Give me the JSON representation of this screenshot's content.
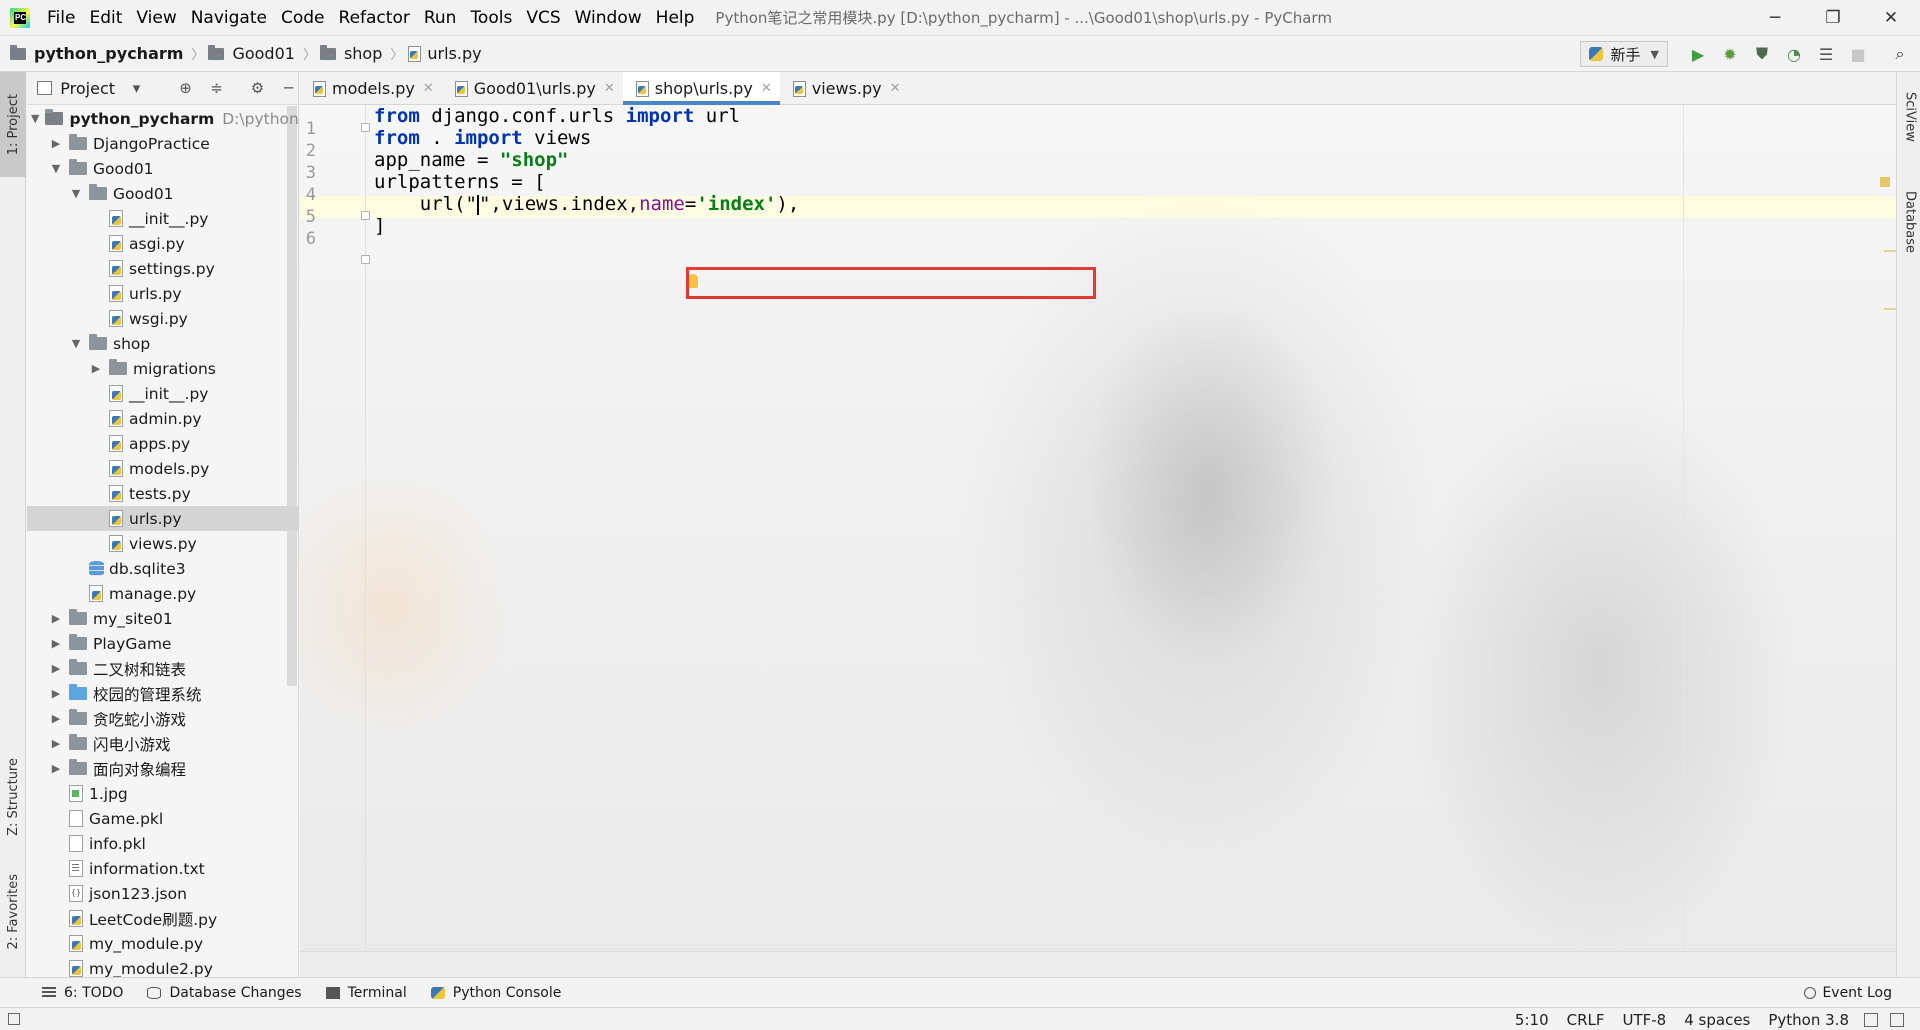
{
  "app": {
    "window_title": "Python笔记之常用模块.py [D:\\python_pycharm] - ...\\Good01\\shop\\urls.py - PyCharm",
    "menu": [
      "File",
      "Edit",
      "View",
      "Navigate",
      "Code",
      "Refactor",
      "Run",
      "Tools",
      "VCS",
      "Window",
      "Help"
    ],
    "window_controls": {
      "minimize": "─",
      "restore": "❐",
      "close": "✕"
    }
  },
  "breadcrumb": [
    "python_pycharm",
    "Good01",
    "shop",
    "urls.py"
  ],
  "run_config": {
    "selected": "新手"
  },
  "left_strip": {
    "project": "1: Project",
    "structure": "Z: Structure",
    "favorites": "2: Favorites"
  },
  "right_strip": {
    "sciview": "SciView",
    "database": "Database"
  },
  "project_panel": {
    "title": "Project",
    "root": {
      "name": "python_pycharm",
      "hint": "D:\\python_p"
    },
    "items": [
      {
        "label": "DjangoPractice"
      },
      {
        "label": "Good01"
      },
      {
        "label": "Good01"
      },
      {
        "label": "__init__.py"
      },
      {
        "label": "asgi.py"
      },
      {
        "label": "settings.py"
      },
      {
        "label": "urls.py"
      },
      {
        "label": "wsgi.py"
      },
      {
        "label": "shop"
      },
      {
        "label": "migrations"
      },
      {
        "label": "__init__.py"
      },
      {
        "label": "admin.py"
      },
      {
        "label": "apps.py"
      },
      {
        "label": "models.py"
      },
      {
        "label": "tests.py"
      },
      {
        "label": "urls.py"
      },
      {
        "label": "views.py"
      },
      {
        "label": "db.sqlite3"
      },
      {
        "label": "manage.py"
      },
      {
        "label": "my_site01"
      },
      {
        "label": "PlayGame"
      },
      {
        "label": "二叉树和链表"
      },
      {
        "label": "校园的管理系统"
      },
      {
        "label": "贪吃蛇小游戏"
      },
      {
        "label": "闪电小游戏"
      },
      {
        "label": "面向对象编程"
      },
      {
        "label": "1.jpg"
      },
      {
        "label": "Game.pkl"
      },
      {
        "label": "info.pkl"
      },
      {
        "label": "information.txt"
      },
      {
        "label": "json123.json"
      },
      {
        "label": "LeetCode刷题.py"
      },
      {
        "label": "my_module.py"
      },
      {
        "label": "my_module2.py"
      }
    ]
  },
  "tabs": [
    {
      "label": "models.py"
    },
    {
      "label": "Good01\\urls.py"
    },
    {
      "label": "shop\\urls.py"
    },
    {
      "label": "views.py"
    }
  ],
  "editor": {
    "line_numbers": [
      "1",
      "2",
      "3",
      "4",
      "5",
      "6"
    ],
    "tokens": {
      "l1_kw1": "from",
      "l1_t1": " django.conf.urls ",
      "l1_kw2": "import",
      "l1_t2": " url",
      "l2_kw1": "from",
      "l2_t1": " . ",
      "l2_kw2": "import",
      "l2_t2": " views",
      "l3_t1": "app_name = ",
      "l3_str": "\"shop\"",
      "l4_t1": "urlpatterns = [",
      "l5_t1": "    url(\"",
      "l5_t2": "\",views.index,",
      "l5_prm": "name",
      "l5_t3": "=",
      "l5_str": "'index'",
      "l5_t4": "),",
      "l6_t1": "]"
    }
  },
  "toolwindows": {
    "todo": "6: TODO",
    "db_changes": "Database Changes",
    "terminal": "Terminal",
    "console": "Python Console",
    "event_log": "Event Log"
  },
  "status": {
    "position": "5:10",
    "line_sep": "CRLF",
    "encoding": "UTF-8",
    "indent": "4 spaces",
    "interpreter": "Python 3.8"
  }
}
